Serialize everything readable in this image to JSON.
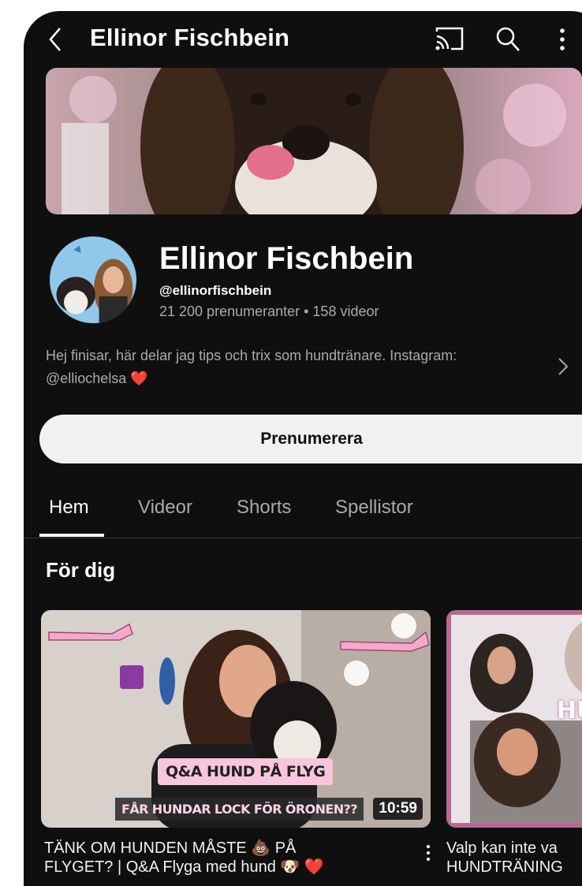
{
  "header": {
    "title": "Ellinor Fischbein",
    "icons": [
      "back-icon",
      "cast-icon",
      "search-icon",
      "more-vert-icon"
    ]
  },
  "channel": {
    "name": "Ellinor Fischbein",
    "handle": "@ellinorfischbein",
    "stats": "21 200 prenumeranter • 158 videor",
    "description_line1": "Hej finisar, här delar jag tips och trix som hundtränare. Instagram:",
    "description_line2": "@elliochelsa ❤️",
    "subscribe_label": "Prenumerera"
  },
  "tabs": [
    {
      "label": "Hem",
      "active": true
    },
    {
      "label": "Videor",
      "active": false
    },
    {
      "label": "Shorts",
      "active": false
    },
    {
      "label": "Spellistor",
      "active": false
    }
  ],
  "section": {
    "title": "För dig"
  },
  "videos": [
    {
      "caption_main": "Q&A HUND PÅ FLYG",
      "caption_sub": "FÅR HUNDAR LOCK FÖR ÖRONEN??",
      "duration": "10:59",
      "title_line1": "TÄNK OM HUNDEN MÅSTE 💩 PÅ",
      "title_line2": "FLYGET? | Q&A Flyga med hund 🐶 ❤️"
    },
    {
      "overlay_text": "HU",
      "title_line1": "Valp kan inte va",
      "title_line2": "HUNDTRÄNING"
    }
  ],
  "colors": {
    "background": "#0f0f0f",
    "text_primary": "#ffffff",
    "text_secondary": "#aaaaaa",
    "button_bg": "#f1f1f1",
    "caption_pink": "#f7c6dc"
  }
}
